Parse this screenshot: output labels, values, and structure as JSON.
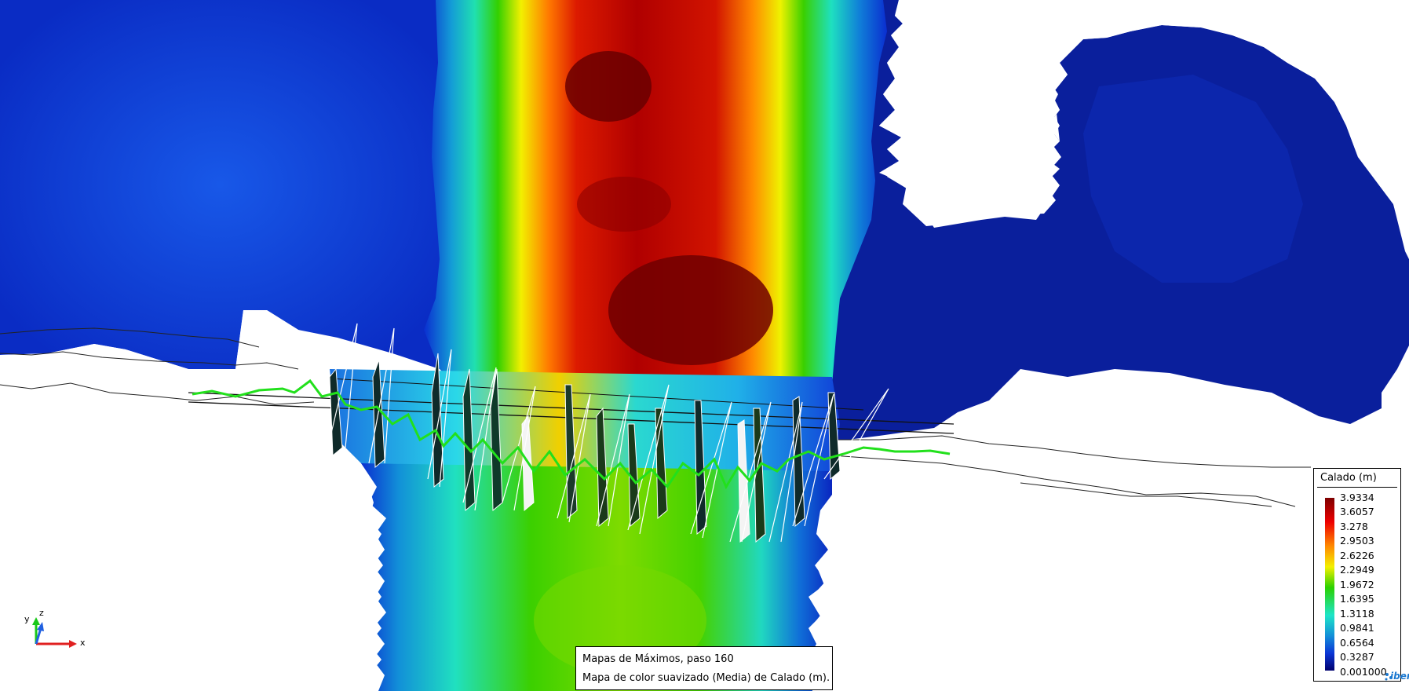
{
  "legend": {
    "title": "Calado (m)",
    "ticks": [
      "3.9334",
      "3.6057",
      "3.278",
      "2.9503",
      "2.6226",
      "2.2949",
      "1.9672",
      "1.6395",
      "1.3118",
      "0.9841",
      "0.6564",
      "0.3287",
      "0.001000"
    ],
    "colors": [
      "#7d0000",
      "#ee0000",
      "#ff8a00",
      "#f3f000",
      "#2ad100",
      "#1ee5c8",
      "#138ed8",
      "#0b36d6",
      "#00006e"
    ]
  },
  "info": {
    "line1": "Mapas de Máximos, paso 160",
    "line2": "Mapa de color suavizado (Media) de Calado (m)."
  },
  "axes": {
    "x": "x",
    "y": "y",
    "z": "z"
  },
  "logo": {
    "text": "iber"
  }
}
